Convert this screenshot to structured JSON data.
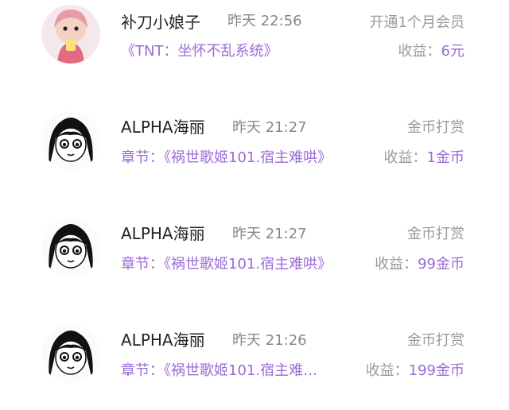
{
  "records": [
    {
      "name": "补刀小娘子",
      "time": "昨天 22:56",
      "type": "开通1个月会员",
      "subtitle": "《TNT：坐怀不乱系统》",
      "earn_label": "收益：",
      "earn_value": "6元",
      "avatar_icon": "girl-avatar-icon"
    },
    {
      "name": "ALPHA海丽",
      "time": "昨天 21:27",
      "type": "金币打赏",
      "subtitle": "章节：《祸世歌姬101.宿主难哄》",
      "earn_label": "收益：",
      "earn_value": "1金币",
      "avatar_icon": "manga-girl-avatar-icon"
    },
    {
      "name": "ALPHA海丽",
      "time": "昨天 21:27",
      "type": "金币打赏",
      "subtitle": "章节：《祸世歌姬101.宿主难哄》",
      "earn_label": "收益：",
      "earn_value": "99金币",
      "avatar_icon": "manga-girl-avatar-icon"
    },
    {
      "name": "ALPHA海丽",
      "time": "昨天 21:26",
      "type": "金币打赏",
      "subtitle": "章节：《祸世歌姬101.宿主难…",
      "earn_label": "收益：",
      "earn_value": "199金币",
      "avatar_icon": "manga-girl-avatar-icon"
    }
  ],
  "colors": {
    "accent": "#9b6ad8",
    "text": "#222222",
    "muted": "#9a9a9a"
  }
}
